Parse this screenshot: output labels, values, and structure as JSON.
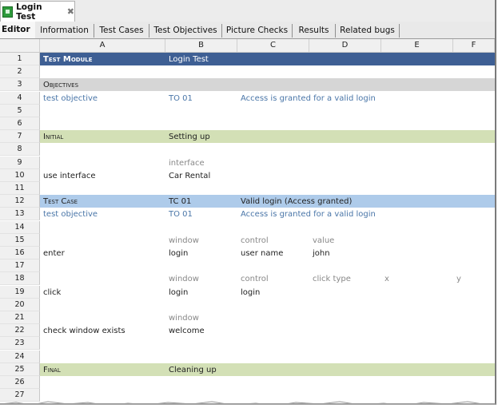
{
  "document_tab": {
    "title": "Login Test",
    "close_glyph": "✖",
    "icon": "testmodule-icon"
  },
  "subtabs": [
    "Editor",
    "Information",
    "Test Cases",
    "Test Objectives",
    "Picture Checks",
    "Results",
    "Related bugs"
  ],
  "columns": [
    "A",
    "B",
    "C",
    "D",
    "E",
    "F"
  ],
  "rows": [
    {
      "n": "1",
      "kind": "module",
      "cells": [
        "Test Module",
        "Login Test",
        "",
        "",
        "",
        ""
      ]
    },
    {
      "n": "2",
      "kind": "blank",
      "cells": []
    },
    {
      "n": "3",
      "kind": "objectives",
      "cells": [
        "Objectives"
      ]
    },
    {
      "n": "4",
      "kind": "data",
      "style": "link",
      "cells": [
        "test objective",
        "TO 01",
        "Access is granted for a valid login"
      ]
    },
    {
      "n": "5",
      "kind": "blank",
      "cells": []
    },
    {
      "n": "6",
      "kind": "blank",
      "cells": []
    },
    {
      "n": "7",
      "kind": "section",
      "cells": [
        "Initial",
        "Setting up"
      ]
    },
    {
      "n": "8",
      "kind": "blank",
      "cells": []
    },
    {
      "n": "9",
      "kind": "hint",
      "cells": [
        "",
        "interface"
      ]
    },
    {
      "n": "10",
      "kind": "data",
      "cells": [
        "use interface",
        "Car Rental"
      ]
    },
    {
      "n": "11",
      "kind": "blank",
      "cells": []
    },
    {
      "n": "12",
      "kind": "testcase",
      "cells": [
        "Test Case",
        "TC 01",
        "Valid login (Access granted)"
      ]
    },
    {
      "n": "13",
      "kind": "data",
      "style": "link",
      "cells": [
        "test objective",
        "TO 01",
        "Access is granted for a valid login"
      ]
    },
    {
      "n": "14",
      "kind": "blank",
      "cells": []
    },
    {
      "n": "15",
      "kind": "hint",
      "cells": [
        "",
        "window",
        "control",
        "value"
      ]
    },
    {
      "n": "16",
      "kind": "data",
      "cells": [
        "enter",
        "login",
        "user name",
        "john"
      ]
    },
    {
      "n": "17",
      "kind": "blank",
      "cells": []
    },
    {
      "n": "18",
      "kind": "hint",
      "cells": [
        "",
        "window",
        "control",
        "click type",
        "x",
        "y"
      ]
    },
    {
      "n": "19",
      "kind": "data",
      "cells": [
        "click",
        "login",
        "login"
      ]
    },
    {
      "n": "20",
      "kind": "blank",
      "cells": []
    },
    {
      "n": "21",
      "kind": "hint",
      "cells": [
        "",
        "window"
      ]
    },
    {
      "n": "22",
      "kind": "data",
      "cells": [
        "check window exists",
        "welcome"
      ]
    },
    {
      "n": "23",
      "kind": "blank",
      "cells": []
    },
    {
      "n": "24",
      "kind": "blank",
      "cells": []
    },
    {
      "n": "25",
      "kind": "section",
      "cells": [
        "Final",
        "Cleaning up"
      ]
    },
    {
      "n": "26",
      "kind": "blank",
      "cells": []
    },
    {
      "n": "27",
      "kind": "blank",
      "cells": []
    }
  ]
}
